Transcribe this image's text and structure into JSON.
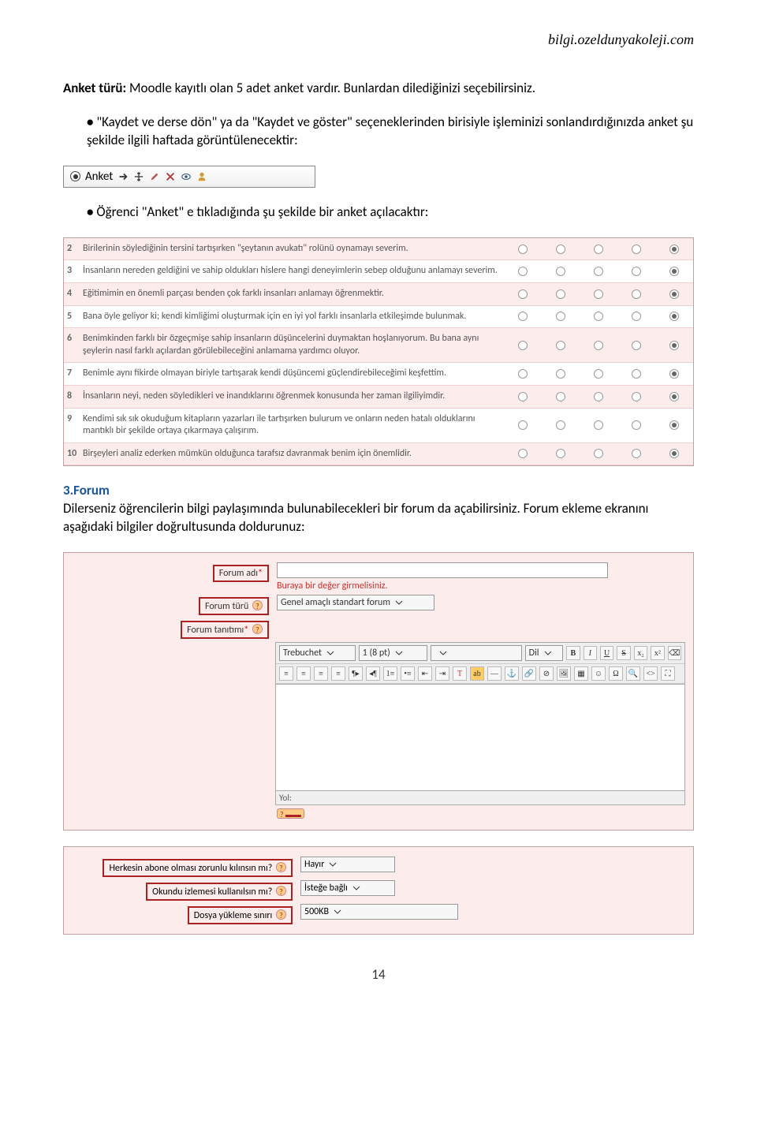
{
  "header": {
    "url": "bilgi.ozeldunyakoleji.com"
  },
  "intro": {
    "label": "Anket türü:",
    "text": " Moodle kayıtlı olan 5 adet anket vardır. Bunlardan dilediğinizi seçebilirsiniz."
  },
  "bullet1": "\"Kaydet ve derse dön\" ya da \"Kaydet ve göster\" seçeneklerinden birisiyle işleminizi sonlandırdığınızda anket şu şekilde ilgili haftada görüntülenecektir:",
  "anket_box": {
    "label": "Anket"
  },
  "bullet2": "Öğrenci \"Anket\" e tıkladığında şu şekilde bir anket açılacaktır:",
  "survey": {
    "rows": [
      {
        "num": "2",
        "text": "Birilerinin söylediğinin tersini tartışırken \"şeytanın avukatı\" rolünü oynamayı severim.",
        "sel": 5
      },
      {
        "num": "3",
        "text": "İnsanların nereden geldiğini ve sahip oldukları hislere hangi deneyimlerin sebep olduğunu anlamayı severim.",
        "sel": 5
      },
      {
        "num": "4",
        "text": "Eğitimimin en önemli parçası benden çok farklı insanları anlamayı öğrenmektir.",
        "sel": 5
      },
      {
        "num": "5",
        "text": "Bana öyle geliyor ki; kendi kimliğimi oluşturmak için en iyi yol farklı insanlarla etkileşimde bulunmak.",
        "sel": 5
      },
      {
        "num": "6",
        "text": "Benimkinden farklı bir özgeçmişe sahip insanların düşüncelerini duymaktan hoşlanıyorum. Bu bana aynı şeylerin nasıl farklı açılardan görülebileceğini anlamama yardımcı oluyor.",
        "sel": 5
      },
      {
        "num": "7",
        "text": "Benimle aynı fikirde olmayan biriyle tartışarak kendi düşüncemi güçlendirebileceğimi keşfettim.",
        "sel": 5
      },
      {
        "num": "8",
        "text": "İnsanların neyi, neden söyledikleri ve inandıklarını öğrenmek konusunda her zaman ilgiliyimdir.",
        "sel": 5
      },
      {
        "num": "9",
        "text": "Kendimi sık sık okuduğum kitapların yazarları ile tartışırken bulurum ve onların neden hatalı olduklarını mantıklı bir şekilde ortaya çıkarmaya çalışırım.",
        "sel": 5
      },
      {
        "num": "10",
        "text": "Birşeyleri analiz ederken mümkün olduğunca tarafsız davranmak benim için önemlidir.",
        "sel": 5
      }
    ]
  },
  "forum": {
    "title": "3.Forum",
    "text": "Dilerseniz öğrencilerin bilgi paylaşımında bulunabilecekleri bir forum da açabilirsiniz. Forum ekleme ekranını aşağıdaki bilgiler doğrultusunda doldurunuz:"
  },
  "form": {
    "name_label": "Forum adı",
    "name_error": "Buraya bir değer girmelisiniz.",
    "type_label": "Forum türü",
    "type_value": "Genel amaçlı standart forum",
    "intro_label": "Forum tanıtımı",
    "toolbar": {
      "font": "Trebuchet",
      "size": "1 (8 pt)",
      "lang": "Dil"
    },
    "path_label": "Yol:",
    "subscribe_label": "Herkesin abone olması zorunlu kılınsın mı?",
    "subscribe_value": "Hayır",
    "tracking_label": "Okundu izlemesi kullanılsın mı?",
    "tracking_value": "İsteğe bağlı",
    "upload_label": "Dosya yükleme sınırı",
    "upload_value": "500KB"
  },
  "page_number": "14"
}
